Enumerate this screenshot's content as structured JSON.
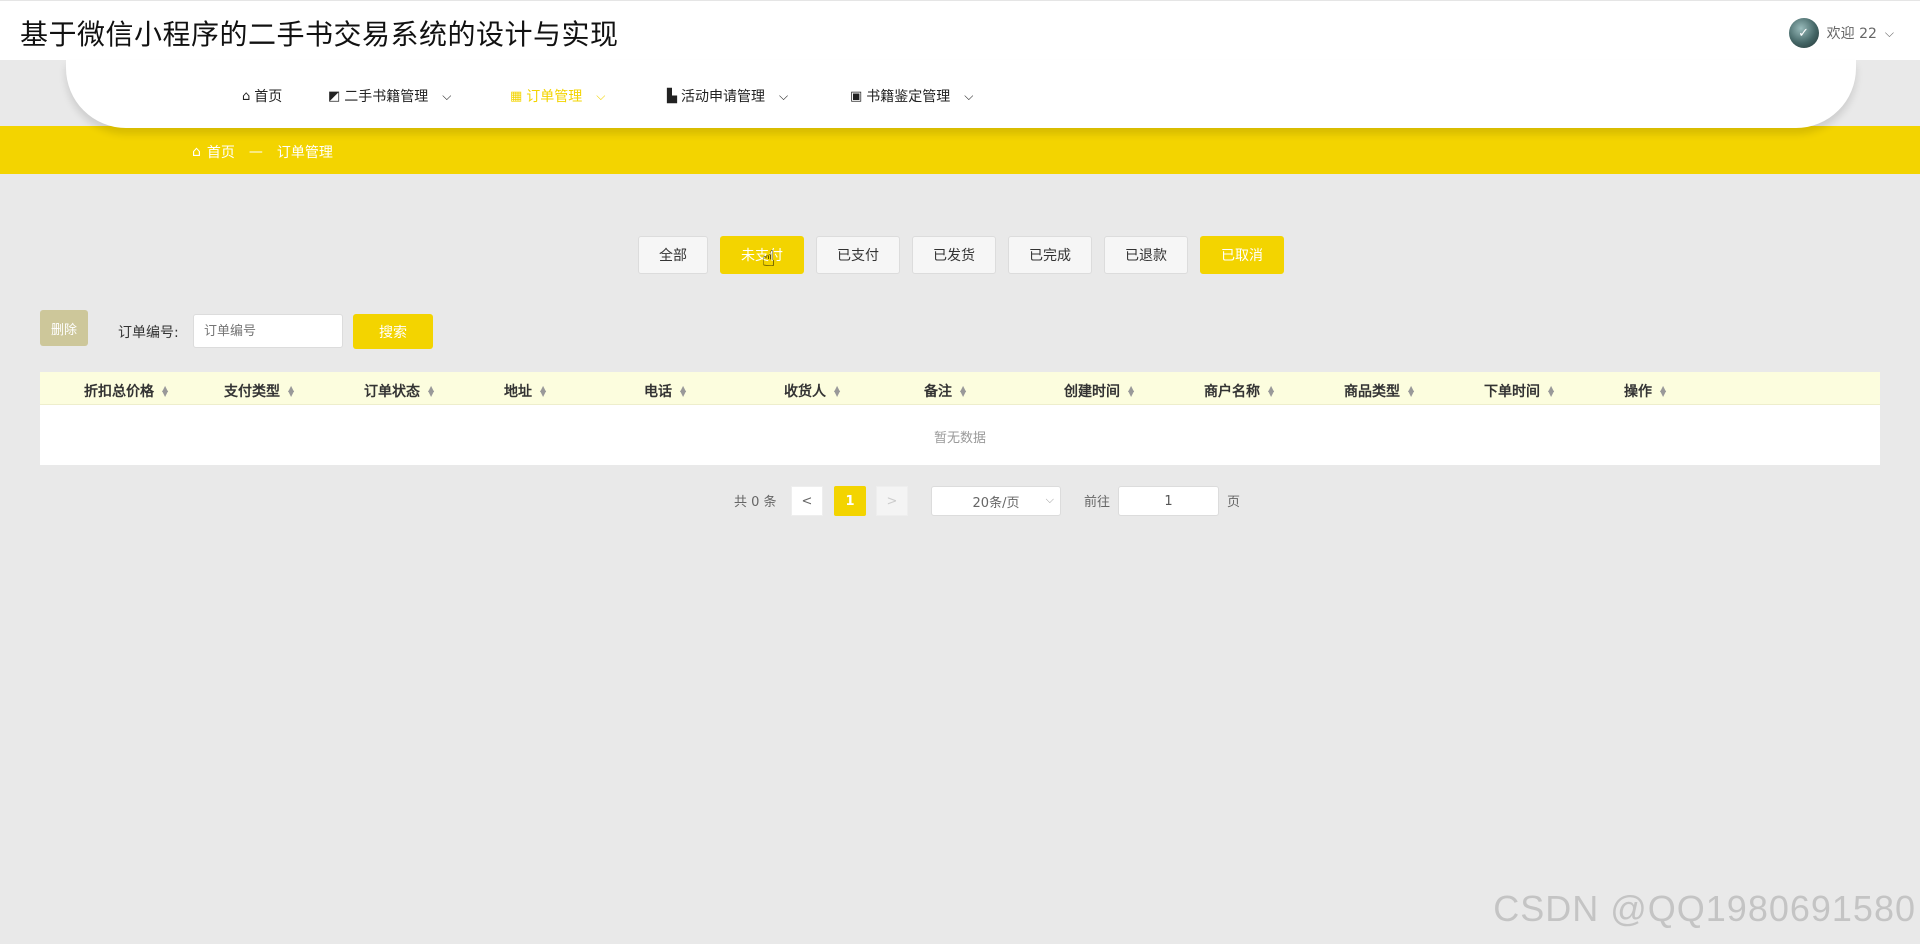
{
  "app": {
    "title": "基于微信小程序的二手书交易系统的设计与实现",
    "user_greeting": "欢迎 22",
    "user_chevron": "⌵"
  },
  "nav": {
    "items": [
      {
        "icon": "⌂",
        "label": "首页",
        "chevron": ""
      },
      {
        "icon": "◩",
        "label": "二手书籍管理",
        "chevron": "⌵"
      },
      {
        "icon": "▦",
        "label": "订单管理",
        "chevron": "⌵"
      },
      {
        "icon": "▙",
        "label": "活动申请管理",
        "chevron": "⌵"
      },
      {
        "icon": "▣",
        "label": "书籍鉴定管理",
        "chevron": "⌵"
      }
    ],
    "active_color": "#f3d400"
  },
  "breadcrumb": {
    "home": "首页",
    "separator": "—",
    "current": "订单管理"
  },
  "tabs": [
    "全部",
    "未支付",
    "已支付",
    "已发货",
    "已完成",
    "已退款",
    "已取消"
  ],
  "toolbar": {
    "delete_label": "删除",
    "order_no_label": "订单编号:",
    "order_no_placeholder": "订单编号",
    "search_label": "搜索"
  },
  "table": {
    "columns": [
      "折扣总价格",
      "支付类型",
      "订单状态",
      "地址",
      "电话",
      "收货人",
      "备注",
      "创建时间",
      "商户名称",
      "商品类型",
      "下单时间",
      "操作"
    ],
    "empty_text": "暂无数据"
  },
  "pagination": {
    "total": "共 0 条",
    "prev": "<",
    "current": "1",
    "next": ">",
    "page_size": "20条/页",
    "goto_label": "前往",
    "goto_value": "1",
    "page_unit": "页"
  },
  "watermark": "CSDN @QQ1980691580",
  "colors": {
    "accent": "#f3d400",
    "background": "#e9e9e9",
    "table_header": "#fcfdde"
  }
}
